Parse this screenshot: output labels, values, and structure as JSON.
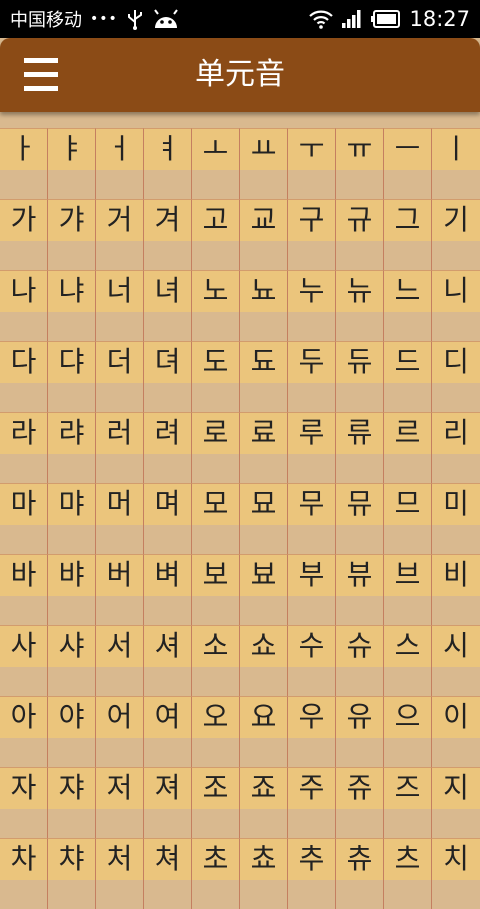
{
  "status_bar": {
    "carrier": "中国移动",
    "dots": "•••",
    "time": "18:27"
  },
  "app_bar": {
    "title": "单元音"
  },
  "grid": {
    "rows": [
      [
        "ㅏ",
        "ㅑ",
        "ㅓ",
        "ㅕ",
        "ㅗ",
        "ㅛ",
        "ㅜ",
        "ㅠ",
        "ㅡ",
        "ㅣ"
      ],
      [
        "가",
        "갸",
        "거",
        "겨",
        "고",
        "교",
        "구",
        "규",
        "그",
        "기"
      ],
      [
        "나",
        "냐",
        "너",
        "녀",
        "노",
        "뇨",
        "누",
        "뉴",
        "느",
        "니"
      ],
      [
        "다",
        "댜",
        "더",
        "뎌",
        "도",
        "됴",
        "두",
        "듀",
        "드",
        "디"
      ],
      [
        "라",
        "랴",
        "러",
        "려",
        "로",
        "료",
        "루",
        "류",
        "르",
        "리"
      ],
      [
        "마",
        "먀",
        "머",
        "며",
        "모",
        "묘",
        "무",
        "뮤",
        "므",
        "미"
      ],
      [
        "바",
        "뱌",
        "버",
        "벼",
        "보",
        "뵤",
        "부",
        "뷰",
        "브",
        "비"
      ],
      [
        "사",
        "샤",
        "서",
        "셔",
        "소",
        "쇼",
        "수",
        "슈",
        "스",
        "시"
      ],
      [
        "아",
        "야",
        "어",
        "여",
        "오",
        "요",
        "우",
        "유",
        "으",
        "이"
      ],
      [
        "자",
        "쟈",
        "저",
        "져",
        "조",
        "죠",
        "주",
        "쥬",
        "즈",
        "지"
      ],
      [
        "차",
        "챠",
        "처",
        "쳐",
        "초",
        "쵸",
        "추",
        "츄",
        "츠",
        "치"
      ]
    ]
  }
}
